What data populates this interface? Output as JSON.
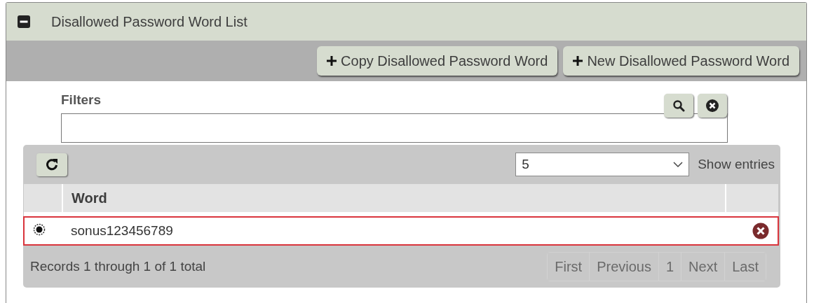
{
  "panel": {
    "title": "Disallowed Password Word List",
    "expanded": true
  },
  "toolbar": {
    "buttons": [
      {
        "label": "Copy Disallowed Password Word"
      },
      {
        "label": "New Disallowed Password Word"
      }
    ]
  },
  "filters": {
    "label": "Filters"
  },
  "table": {
    "page_size": "5",
    "page_size_label": "Show entries",
    "columns": [
      "Word"
    ],
    "rows": [
      {
        "word": "sonus123456789",
        "selected": true
      }
    ],
    "summary": "Records 1 through 1 of 1 total",
    "pagination": [
      {
        "label": "First",
        "disabled": true
      },
      {
        "label": "Previous",
        "disabled": true
      },
      {
        "label": "1",
        "disabled": true
      },
      {
        "label": "Next",
        "disabled": true
      },
      {
        "label": "Last",
        "disabled": true
      }
    ]
  }
}
